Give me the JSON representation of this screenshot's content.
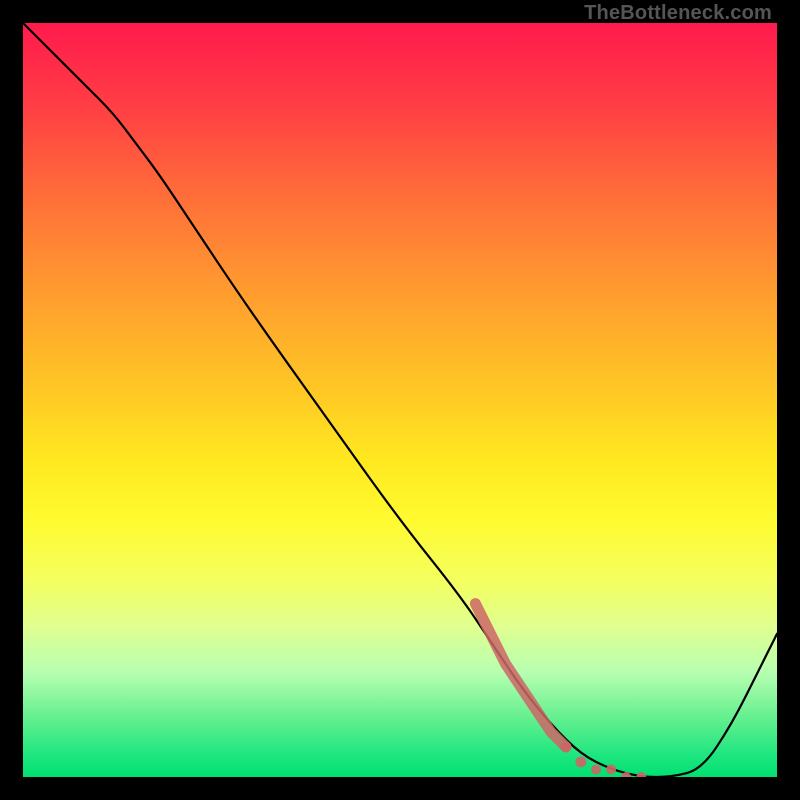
{
  "watermark": "TheBottleneck.com",
  "colors": {
    "red_top": "#ff1a4d",
    "orange_mid": "#ffb030",
    "yellow_mid": "#ffff33",
    "pale_green": "#ccffcc",
    "green_bottom": "#00e676",
    "curve_stroke": "#000000",
    "marker": "#cc6666",
    "frame": "#000000"
  },
  "chart_data": {
    "type": "line",
    "title": "",
    "xlabel": "",
    "ylabel": "",
    "xlim": [
      0,
      100
    ],
    "ylim": [
      0,
      100
    ],
    "series": [
      {
        "name": "bottleneck-curve",
        "x": [
          0,
          4,
          8,
          12,
          15,
          18,
          22,
          30,
          40,
          50,
          58,
          62,
          66,
          70,
          74,
          78,
          82,
          86,
          90,
          94,
          98,
          100
        ],
        "y": [
          100,
          96,
          92,
          88,
          84,
          80,
          74,
          62,
          48,
          34,
          24,
          18,
          12,
          7,
          3,
          1,
          0,
          0,
          1,
          7,
          15,
          19
        ]
      }
    ],
    "markers": {
      "name": "highlight-segment",
      "x": [
        60,
        62,
        64,
        66,
        68,
        70,
        72,
        74,
        76,
        78,
        80,
        82
      ],
      "y": [
        23,
        19,
        15,
        12,
        9,
        6,
        4,
        2,
        1,
        1,
        0,
        0
      ]
    },
    "gradient_stops": [
      {
        "pct": 0,
        "color": "#ff1a4d"
      },
      {
        "pct": 10,
        "color": "#ff3a45"
      },
      {
        "pct": 22,
        "color": "#ff6a3a"
      },
      {
        "pct": 35,
        "color": "#ff9a30"
      },
      {
        "pct": 48,
        "color": "#ffc525"
      },
      {
        "pct": 58,
        "color": "#ffe820"
      },
      {
        "pct": 66,
        "color": "#fffb30"
      },
      {
        "pct": 74,
        "color": "#f4ff60"
      },
      {
        "pct": 80,
        "color": "#e0ff90"
      },
      {
        "pct": 86,
        "color": "#b8ffb0"
      },
      {
        "pct": 92,
        "color": "#66f090"
      },
      {
        "pct": 97,
        "color": "#1fe680"
      },
      {
        "pct": 100,
        "color": "#00e070"
      }
    ]
  }
}
